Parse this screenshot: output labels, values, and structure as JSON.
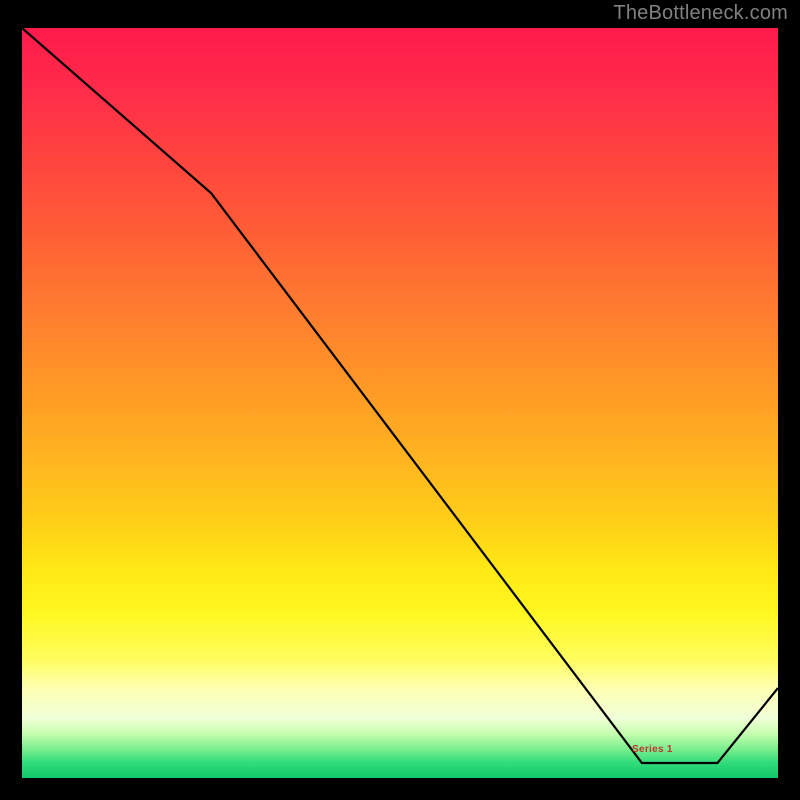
{
  "watermark": "TheBottleneck.com",
  "series_label": "Series 1",
  "colors": {
    "gradient_top": "#ff1a4b",
    "gradient_bottom": "#10c86a",
    "curve": "#000000",
    "label": "#c0392b"
  },
  "chart_data": {
    "type": "line",
    "title": "",
    "xlabel": "",
    "ylabel": "",
    "xlim": [
      0,
      100
    ],
    "ylim": [
      0,
      100
    ],
    "x": [
      0,
      25,
      82,
      92,
      100
    ],
    "values": [
      100,
      78,
      2,
      2,
      12
    ],
    "series": [
      {
        "name": "Series 1",
        "values": [
          100,
          78,
          2,
          2,
          12
        ]
      }
    ],
    "annotations": [
      {
        "text": "Series 1",
        "x": 86,
        "y": 4
      }
    ]
  }
}
